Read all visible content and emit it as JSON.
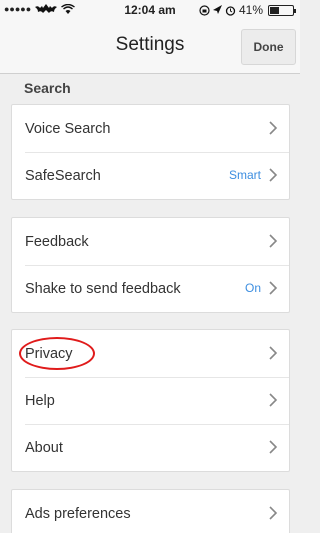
{
  "status_bar": {
    "signal": "●●●●●",
    "time": "12:04 am",
    "battery_percent": "41%",
    "battery_level": 0.41
  },
  "nav": {
    "title": "Settings",
    "done_label": "Done"
  },
  "search_section": {
    "header": "Search",
    "items": [
      {
        "label": "Voice Search",
        "value": ""
      },
      {
        "label": "SafeSearch",
        "value": "Smart"
      }
    ]
  },
  "feedback_section": {
    "items": [
      {
        "label": "Feedback",
        "value": ""
      },
      {
        "label": "Shake to send feedback",
        "value": "On"
      }
    ]
  },
  "info_section": {
    "items": [
      {
        "label": "Privacy",
        "value": ""
      },
      {
        "label": "Help",
        "value": ""
      },
      {
        "label": "About",
        "value": ""
      }
    ]
  },
  "ads_section": {
    "items": [
      {
        "label": "Ads preferences",
        "value": ""
      }
    ]
  },
  "colors": {
    "accent": "#3d8ee0",
    "annotation": "#e01b1b"
  }
}
